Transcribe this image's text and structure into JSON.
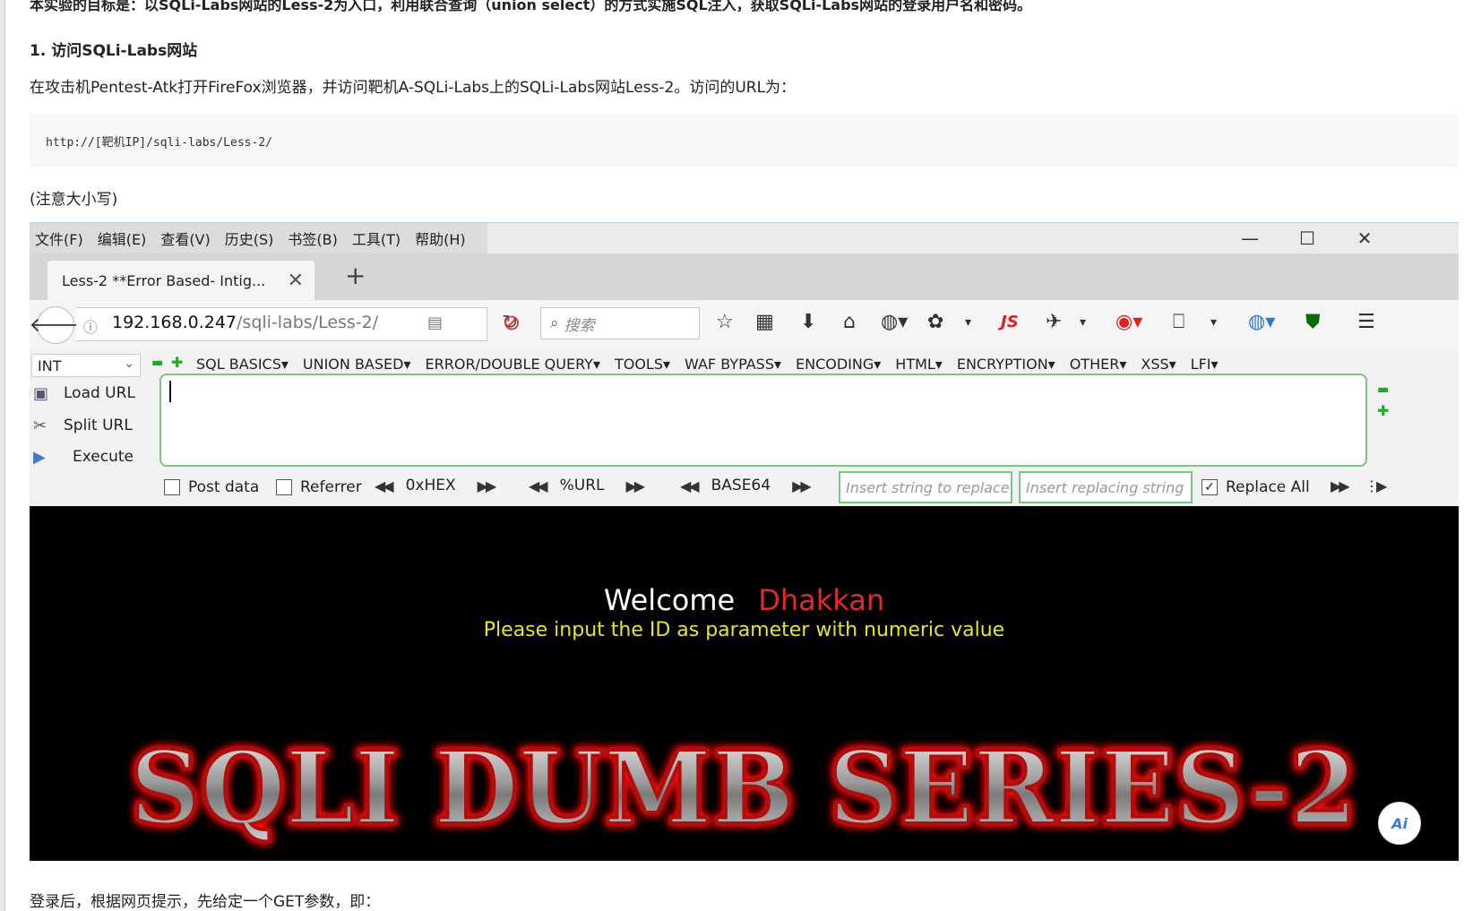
{
  "article": {
    "top_cut_text": "本实验的目标是：以SQLi-Labs网站的Less-2为入口，利用联合查询（union select）的方式实施SQL注入，获取SQLi-Labs网站的登录用户名和密码。",
    "step_heading": "1. 访问SQLi-Labs网站",
    "intro": "在攻击机Pentest-Atk打开FireFox浏览器，并访问靶机A-SQLi-Labs上的SQLi-Labs网站Less-2。访问的URL为：",
    "code_url": "http://[靶机IP]/sqli-labs/Less-2/",
    "note": "(注意大小写)",
    "after": "登录后，根据网页提示，先给定一个GET参数，即："
  },
  "browser": {
    "menu": [
      "文件(F)",
      "编辑(E)",
      "查看(V)",
      "历史(S)",
      "书签(B)",
      "工具(T)",
      "帮助(H)"
    ],
    "tab_title": "Less-2 **Error Based- Intig...",
    "url_host": "192.168.0.247",
    "url_path": "/sqli-labs/Less-2/",
    "search_placeholder": "搜索",
    "js_label": "JS"
  },
  "hackbar": {
    "select_value": "INT",
    "menus": [
      "SQL BASICS▾",
      "UNION BASED▾",
      "ERROR/DOUBLE QUERY▾",
      "TOOLS▾",
      "WAF BYPASS▾",
      "ENCODING▾",
      "HTML▾",
      "ENCRYPTION▾",
      "OTHER▾",
      "XSS▾",
      "LFI▾"
    ],
    "load_url": "Load URL",
    "split_url": "Split URL",
    "execute": "Execute",
    "post_data": "Post data",
    "referrer": "Referrer",
    "hex": "0xHEX",
    "url_enc": "%URL",
    "base64": "BASE64",
    "replace_ph": "Insert string to replace",
    "replacing_ph": "Insert replacing string",
    "replace_all": "Replace All"
  },
  "page": {
    "welcome": "Welcome",
    "name": "Dhakkan",
    "prompt": "Please input the ID as parameter with numeric value",
    "banner": "SQLI DUMB SERIES-2"
  },
  "colors": {
    "welcome_name": "#e12b2b",
    "prompt": "#e5e52c",
    "hackbar_green": "#7bc67b"
  },
  "ai_button": "Ai"
}
